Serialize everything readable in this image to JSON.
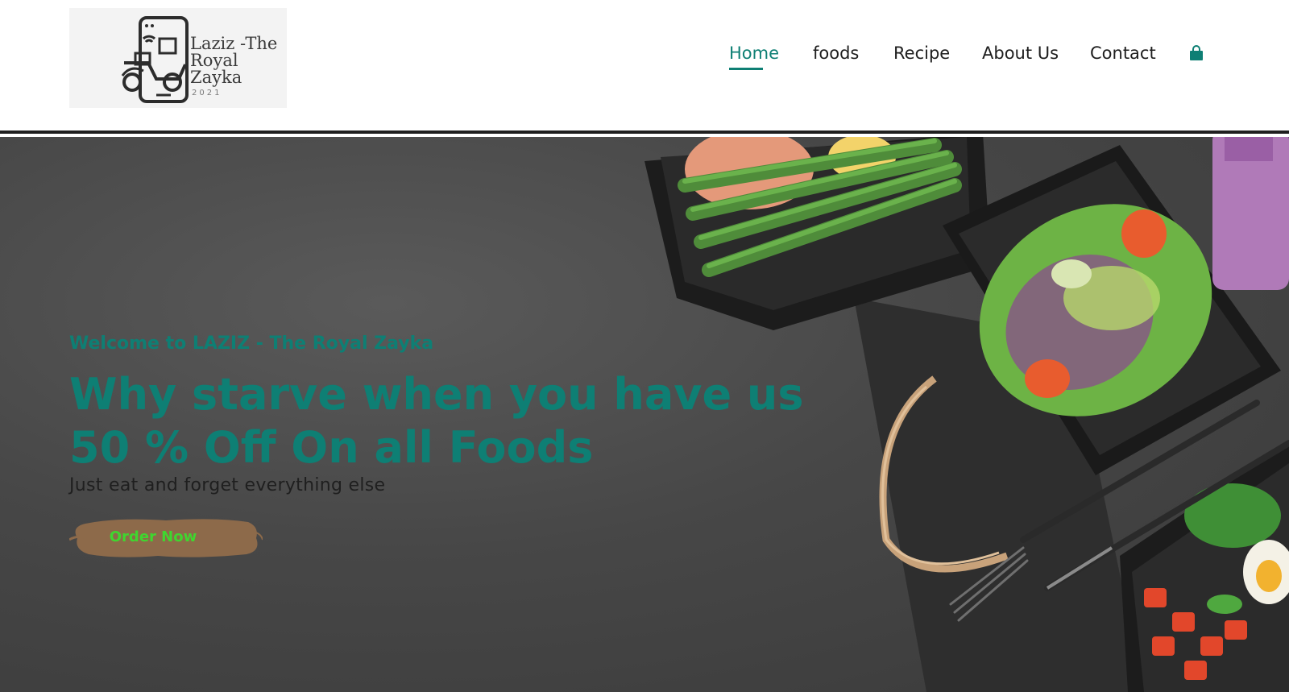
{
  "logo": {
    "name": "Laziz -The\nRoyal\nZayka",
    "year": "2021"
  },
  "nav": {
    "items": [
      {
        "label": "Home",
        "active": true
      },
      {
        "label": "foods",
        "active": false
      },
      {
        "label": "Recipe",
        "active": false
      },
      {
        "label": "About Us",
        "active": false
      },
      {
        "label": "Contact",
        "active": false
      }
    ],
    "cart_icon": "shopping-bag-icon"
  },
  "hero": {
    "welcome": "Welcome to LAZIZ - The Royal Zayka",
    "headline_line1": "Why starve when you have us",
    "headline_line2": "50 % Off On all Foods",
    "tagline": "Just eat and forget everything else",
    "cta_label": "Order Now"
  },
  "colors": {
    "accent": "#0e7f74",
    "cta_text": "#3fd62f",
    "cta_brush": "#8d6a4a",
    "hero_bg": "#474747"
  }
}
